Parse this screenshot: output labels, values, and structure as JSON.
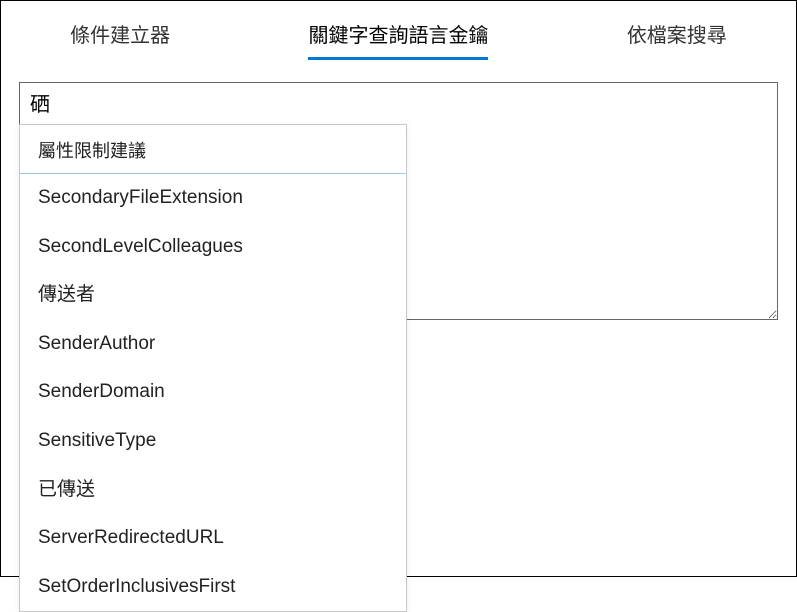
{
  "tabs": [
    {
      "label": "條件建立器",
      "active": false
    },
    {
      "label": "關鍵字查詢語言金鑰",
      "active": true
    },
    {
      "label": "依檔案搜尋",
      "active": false
    }
  ],
  "query_input": {
    "value": "硒"
  },
  "dropdown": {
    "header": "屬性限制建議",
    "items": [
      "SecondaryFileExtension",
      "SecondLevelColleagues",
      "傳送者",
      "SenderAuthor",
      "SenderDomain",
      "SensitiveType",
      "已傳送",
      "ServerRedirectedURL",
      "SetOrderInclusivesFirst"
    ]
  }
}
